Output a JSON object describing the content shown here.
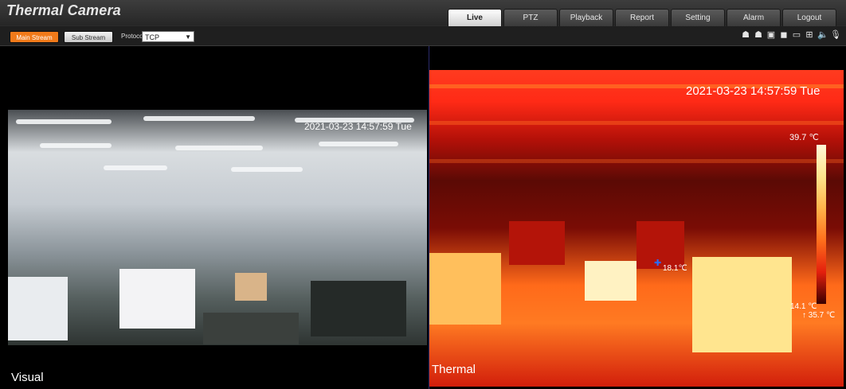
{
  "header": {
    "brand": "Thermal Camera",
    "nav": [
      "Live",
      "PTZ",
      "Playback",
      "Report",
      "Setting",
      "Alarm",
      "Logout"
    ],
    "active_nav": "Live"
  },
  "toolbar": {
    "main_stream_label": "Main Stream",
    "sub_stream_label": "Sub Stream",
    "protocol_label": "Protocol",
    "protocol_value": "TCP",
    "icons": [
      "person-icon",
      "person-icon",
      "snapshot-icon",
      "record-icon",
      "camera-icon",
      "zoom-icon",
      "speaker-icon",
      "mic-icon"
    ]
  },
  "visual": {
    "timestamp": "2021-03-23 14:57:59 Tue",
    "label": "Visual"
  },
  "thermal": {
    "timestamp": "2021-03-23 14:57:59 Tue",
    "label": "Thermal",
    "scale_max": "39.7 ℃",
    "scale_min": "14.1 ℃",
    "spot_temp": "18.1℃",
    "marker_right": "↑ 35.7 ℃"
  },
  "colors": {
    "accent_orange": "#f07a1a",
    "thermal_hot": "#ffe48c",
    "thermal_mid": "#ff3b1f"
  }
}
